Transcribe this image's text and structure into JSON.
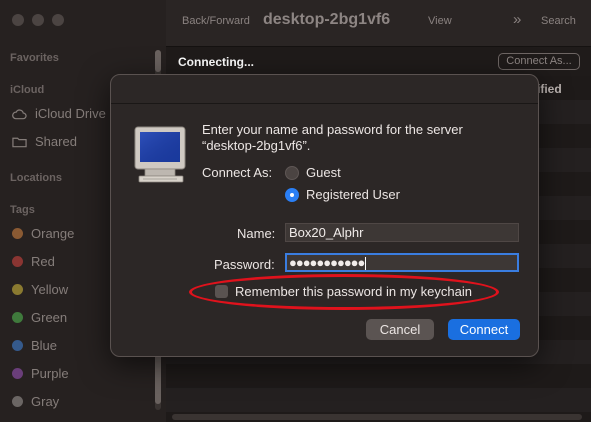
{
  "sidebar": {
    "favorites_label": "Favorites",
    "icloud_label": "iCloud",
    "icloud_items": [
      {
        "label": "iCloud Drive",
        "icon": "cloud-icon"
      },
      {
        "label": "Shared",
        "icon": "shared-folder-icon"
      }
    ],
    "locations_label": "Locations",
    "tags_label": "Tags",
    "tags": [
      {
        "label": "Orange",
        "color": "#8a5a33"
      },
      {
        "label": "Red",
        "color": "#8a3532"
      },
      {
        "label": "Yellow",
        "color": "#8a7a30"
      },
      {
        "label": "Green",
        "color": "#3f7a3c"
      },
      {
        "label": "Blue",
        "color": "#355a8c"
      },
      {
        "label": "Purple",
        "color": "#6a3e7a"
      },
      {
        "label": "Gray",
        "color": "#6b6664"
      }
    ]
  },
  "toolbar": {
    "back_forward": "Back/Forward",
    "title": "desktop-2bg1vf6",
    "view": "View",
    "search": "Search"
  },
  "status": {
    "connecting": "Connecting...",
    "connect_as_button": "Connect As...",
    "column_header_partial": "ified"
  },
  "dialog": {
    "message_line1": "Enter your name and password for the server",
    "message_line2": "“desktop-2bg1vf6”.",
    "connect_as_label": "Connect As:",
    "option_guest": "Guest",
    "option_registered": "Registered User",
    "selected_option": "Registered User",
    "name_label": "Name:",
    "name_value": "Box20_Alphr",
    "password_label": "Password:",
    "password_masked": "●●●●●●●●●●●",
    "remember_label": "Remember this password in my keychain",
    "remember_checked": false,
    "cancel_label": "Cancel",
    "connect_label": "Connect",
    "accent_color": "#1a6fe0",
    "highlight_color": "#e0121c"
  }
}
